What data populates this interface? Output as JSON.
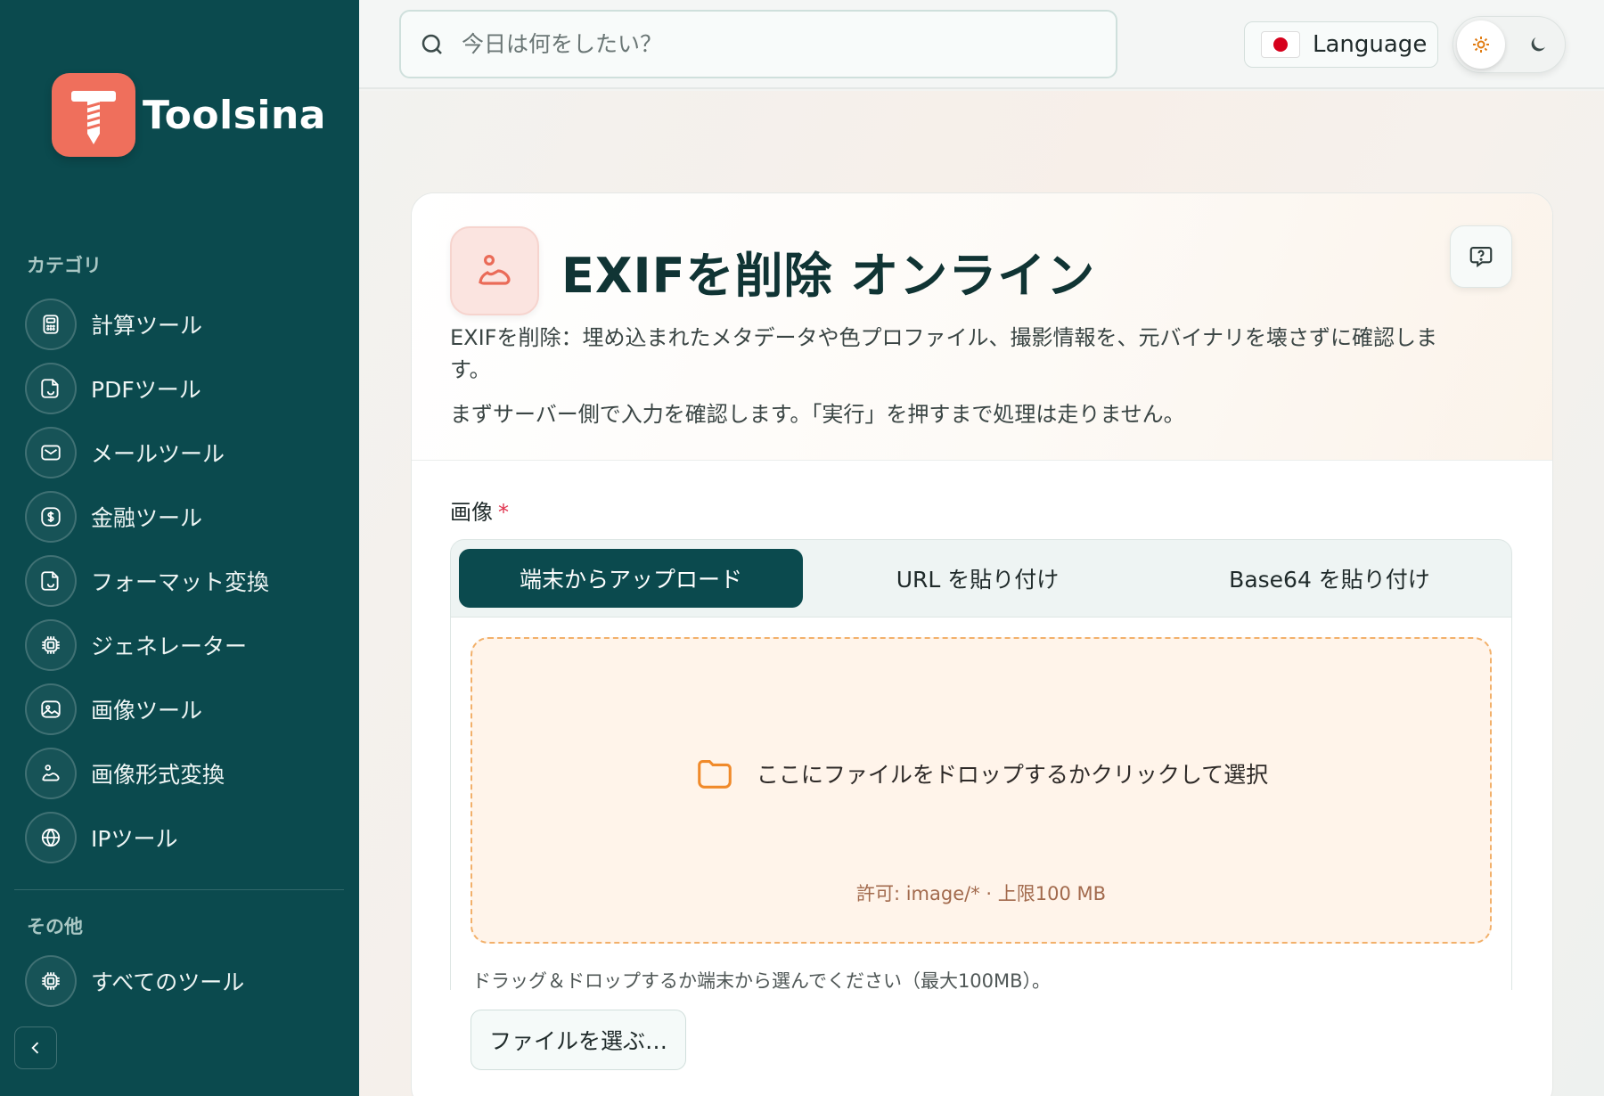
{
  "brand": {
    "name": "Toolsina",
    "accent": "#0b4a4e",
    "logo_color": "#ef6f5c"
  },
  "sidebar": {
    "categories_label": "カテゴリ",
    "items": [
      {
        "label": "計算ツール",
        "icon": "calculator-icon"
      },
      {
        "label": "PDFツール",
        "icon": "pdf-icon"
      },
      {
        "label": "メールツール",
        "icon": "mail-icon"
      },
      {
        "label": "金融ツール",
        "icon": "dollar-icon"
      },
      {
        "label": "フォーマット変換",
        "icon": "convert-icon"
      },
      {
        "label": "ジェネレーター",
        "icon": "chip-icon"
      },
      {
        "label": "画像ツール",
        "icon": "image-icon"
      },
      {
        "label": "画像形式変換",
        "icon": "image-convert-icon"
      },
      {
        "label": "IPツール",
        "icon": "globe-icon"
      }
    ],
    "other_label": "その他",
    "all_tools": {
      "label": "すべてのツール",
      "icon": "chip-icon"
    },
    "collapse_icon": "chevron-left-icon"
  },
  "topbar": {
    "search_placeholder": "今日は何をしたい？",
    "language_label": "Language",
    "theme": {
      "active": "light",
      "icons": [
        "sun-icon",
        "moon-icon"
      ]
    }
  },
  "tool": {
    "title": "EXIFを削除 オンライン",
    "description": "EXIFを削除：埋め込まれたメタデータや色プロファイル、撮影情報を、元バイナリを壊さずに確認します。",
    "note": "まずサーバー側で入力を確認します。「実行」を押すまで処理は走りません。",
    "field_label": "画像",
    "required_mark": "*",
    "tabs": [
      {
        "label": "端末からアップロード",
        "active": true
      },
      {
        "label": "URL を貼り付け",
        "active": false
      },
      {
        "label": "Base64 を貼り付け",
        "active": false
      }
    ],
    "dropzone_text": "ここにファイルをドロップするかクリックして選択",
    "dropzone_hint": "許可: image/* · 上限100 MB",
    "upload_note": "ドラッグ＆ドロップするか端末から選んでください（最大100MB）。",
    "file_button": "ファイルを選ぶ…"
  }
}
